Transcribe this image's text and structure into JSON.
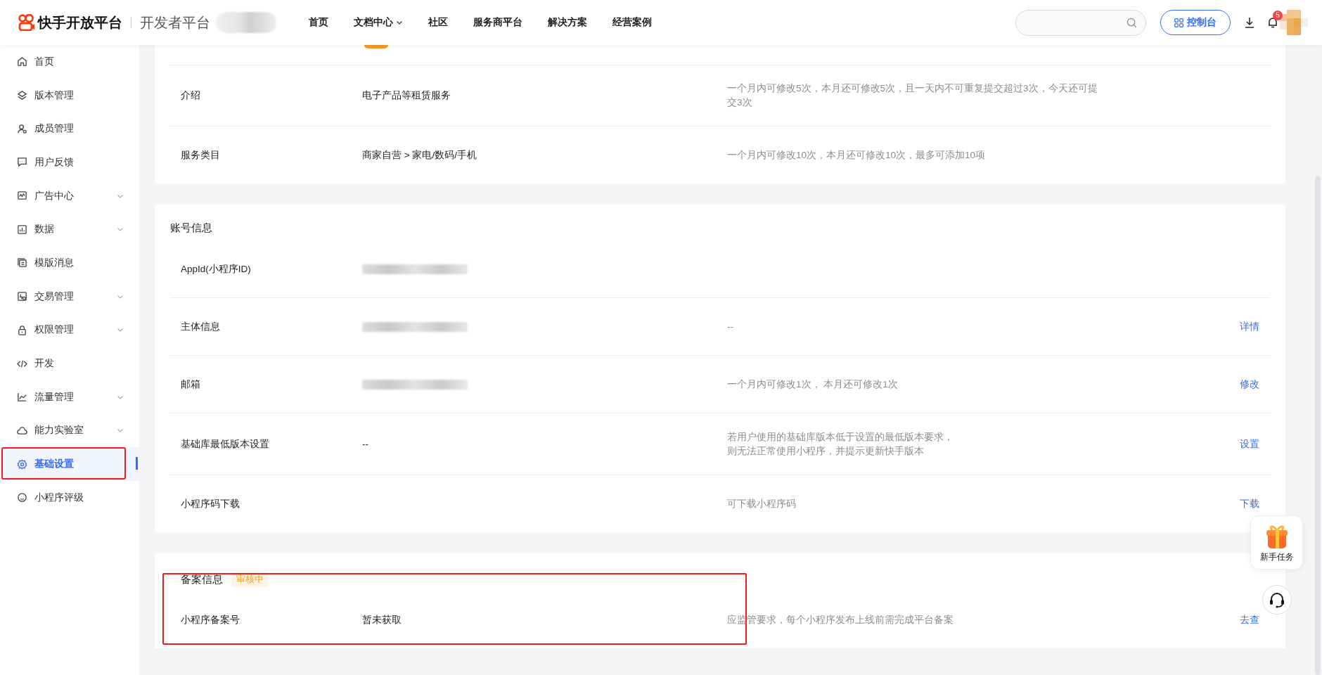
{
  "header": {
    "logo_text": "快手开放平台",
    "subtitle": "开发者平台",
    "nav": [
      {
        "label": "首页",
        "dropdown": false
      },
      {
        "label": "文档中心",
        "dropdown": true
      },
      {
        "label": "社区",
        "dropdown": false
      },
      {
        "label": "服务商平台",
        "dropdown": false
      },
      {
        "label": "解决方案",
        "dropdown": false
      },
      {
        "label": "经营案例",
        "dropdown": false
      }
    ],
    "console_button": "控制台",
    "notification_count": "5"
  },
  "sidebar": {
    "items": [
      {
        "label": "首页",
        "expandable": false,
        "selected": false
      },
      {
        "label": "版本管理",
        "expandable": false,
        "selected": false
      },
      {
        "label": "成员管理",
        "expandable": false,
        "selected": false
      },
      {
        "label": "用户反馈",
        "expandable": false,
        "selected": false
      },
      {
        "label": "广告中心",
        "expandable": true,
        "selected": false
      },
      {
        "label": "数据",
        "expandable": true,
        "selected": false
      },
      {
        "label": "模版消息",
        "expandable": false,
        "selected": false
      },
      {
        "label": "交易管理",
        "expandable": true,
        "selected": false
      },
      {
        "label": "权限管理",
        "expandable": true,
        "selected": false
      },
      {
        "label": "开发",
        "expandable": false,
        "selected": false
      },
      {
        "label": "流量管理",
        "expandable": true,
        "selected": false
      },
      {
        "label": "能力实验室",
        "expandable": true,
        "selected": false
      },
      {
        "label": "基础设置",
        "expandable": false,
        "selected": true,
        "highlighted": true
      },
      {
        "label": "小程序评级",
        "expandable": false,
        "selected": false
      }
    ]
  },
  "basic_card": {
    "rows": [
      {
        "label": "介绍",
        "value": "电子产品等租赁服务",
        "note": "一个月内可修改5次，本月还可修改5次，且一天内不可重复提交超过3次，今天还可提交3次"
      },
      {
        "label": "服务类目",
        "value": "商家自营 > 家电/数码/手机",
        "note": "一个月内可修改10次，本月还可修改10次，最多可添加10项"
      }
    ]
  },
  "account_card": {
    "title": "账号信息",
    "rows": [
      {
        "label": "AppId(小程序ID)",
        "redacted": true
      },
      {
        "label": "主体信息",
        "redacted": true,
        "note": "--",
        "action": "详情"
      },
      {
        "label": "邮箱",
        "redacted": true,
        "note": "一个月内可修改1次， 本月还可修改1次",
        "action": "修改"
      },
      {
        "label": "基础库最低版本设置",
        "value": "--",
        "note_lines": [
          "若用户使用的基础库版本低于设置的最低版本要求，",
          "则无法正常使用小程序，并提示更新快手版本"
        ],
        "action": "设置"
      },
      {
        "label": "小程序码下载",
        "note": "可下载小程序码",
        "action": "下载"
      }
    ]
  },
  "filing_card": {
    "title": "备案信息",
    "status": "审核中",
    "highlighted": true,
    "rows": [
      {
        "label": "小程序备案号",
        "value": "暂未获取",
        "note": "应监管要求，每个小程序发布上线前需完成平台备案",
        "action": "去查"
      }
    ]
  },
  "float_widgets": {
    "task_label": "新手任务"
  }
}
